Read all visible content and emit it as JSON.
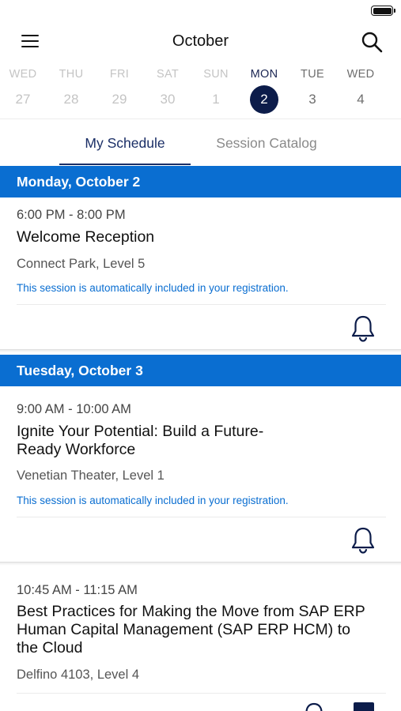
{
  "header": {
    "title": "October"
  },
  "week": [
    {
      "dow": "WED",
      "num": "27",
      "state": "past"
    },
    {
      "dow": "THU",
      "num": "28",
      "state": "past"
    },
    {
      "dow": "FRI",
      "num": "29",
      "state": "past"
    },
    {
      "dow": "SAT",
      "num": "30",
      "state": "past"
    },
    {
      "dow": "SUN",
      "num": "1",
      "state": "past"
    },
    {
      "dow": "MON",
      "num": "2",
      "state": "selected"
    },
    {
      "dow": "TUE",
      "num": "3",
      "state": "future"
    },
    {
      "dow": "WED",
      "num": "4",
      "state": "future"
    }
  ],
  "tabs": {
    "my_schedule": "My Schedule",
    "session_catalog": "Session Catalog",
    "active": "my_schedule"
  },
  "days": [
    {
      "label": "Monday, October 2",
      "sessions": [
        {
          "time": "6:00 PM - 8:00 PM",
          "title": "Welcome Reception",
          "room": "Connect Park, Level 5",
          "note": "This session is automatically included in your registration."
        }
      ]
    },
    {
      "label": "Tuesday, October 3",
      "sessions": [
        {
          "time": "9:00 AM - 10:00 AM",
          "title_lines": [
            "Ignite Your Potential: Build a Future-",
            "Ready Workforce"
          ],
          "room": "Venetian Theater, Level 1",
          "note": "This session is automatically included in your registration."
        },
        {
          "time": "10:45 AM - 11:15 AM",
          "title_lines": [
            "Best Practices for Making the Move from SAP ERP",
            "Human Capital Management (SAP ERP HCM) to",
            "the Cloud"
          ],
          "room": "Delfino 4103, Level 4"
        }
      ]
    }
  ],
  "colors": {
    "accent": "#0a6ed1",
    "selected_day": "#0c1c4a",
    "tab_active": "#1a2e66",
    "note_text": "#0a6ed1"
  },
  "icons": {
    "menu": "hamburger-menu-icon",
    "search": "search-icon",
    "reminder": "bell-icon",
    "battery": "battery-icon"
  }
}
